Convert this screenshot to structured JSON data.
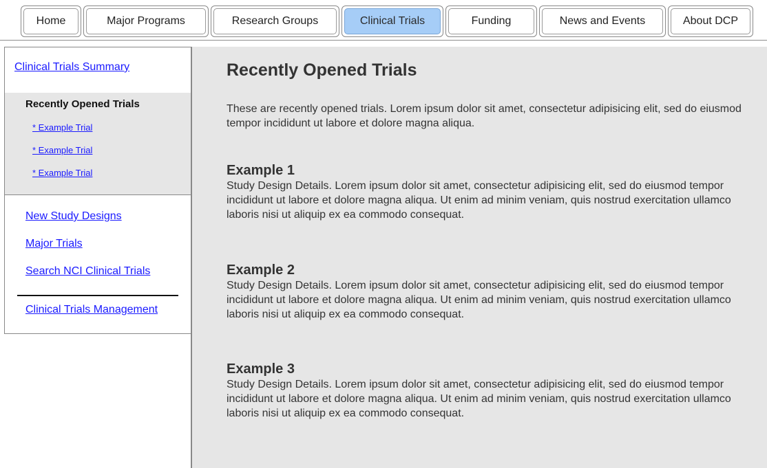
{
  "nav": {
    "tabs": [
      {
        "label": "Home",
        "active": false
      },
      {
        "label": "Major Programs",
        "active": false
      },
      {
        "label": "Research Groups",
        "active": false
      },
      {
        "label": "Clinical Trials",
        "active": true
      },
      {
        "label": "Funding",
        "active": false
      },
      {
        "label": "News and Events",
        "active": false
      },
      {
        "label": "About DCP",
        "active": false
      }
    ]
  },
  "sidebar": {
    "summary_link": "Clinical Trials Summary",
    "subnav": {
      "heading": "Recently Opened Trials",
      "items": [
        "* Example Trial",
        "* Example Trial",
        "* Example Trial"
      ]
    },
    "links": [
      "New Study Designs",
      "Major Trials",
      "Search NCI Clinical Trials",
      "Clinical Trials Management"
    ]
  },
  "main": {
    "title": "Recently Opened Trials",
    "intro": "These are recently opened trials.  Lorem ipsum dolor sit amet, consectetur adipisicing elit, sed do eiusmod tempor incididunt ut labore et dolore magna aliqua.",
    "sections": [
      {
        "title": "Example 1",
        "body": "Study Design Details. Lorem ipsum dolor sit amet, consectetur adipisicing elit, sed do eiusmod tempor incididunt ut labore et dolore magna aliqua. Ut enim ad minim veniam, quis nostrud exercitation ullamco laboris nisi ut aliquip ex ea commodo consequat."
      },
      {
        "title": "Example 2",
        "body": "Study Design Details. Lorem ipsum dolor sit amet, consectetur adipisicing elit, sed do eiusmod tempor incididunt ut labore et dolore magna aliqua. Ut enim ad minim veniam, quis nostrud exercitation ullamco laboris nisi ut aliquip ex ea commodo consequat."
      },
      {
        "title": "Example 3",
        "body": "Study Design Details. Lorem ipsum dolor sit amet, consectetur adipisicing elit, sed do eiusmod tempor incididunt ut labore et dolore magna aliqua. Ut enim ad minim veniam, quis nostrud exercitation ullamco laboris nisi ut aliquip ex ea commodo consequat."
      }
    ]
  },
  "colors": {
    "active_tab": "#a6cdf7",
    "link": "#1a1aff",
    "panel_bg": "#e6e6e6"
  }
}
